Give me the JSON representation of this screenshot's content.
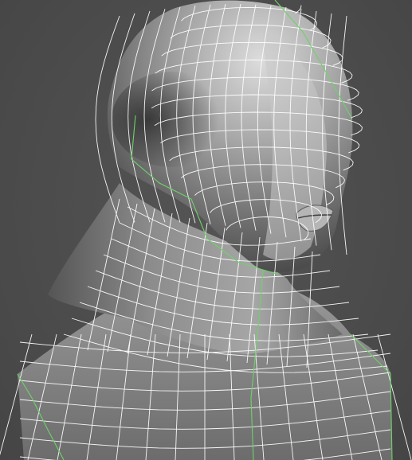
{
  "viewport": {
    "background_color": "#4d4d4d",
    "model_base_color": "#9a9a9a",
    "wire_color": "#ffffff",
    "seam_color": "#6fd26a",
    "model": "sculpted-head-bust-wireframe"
  }
}
